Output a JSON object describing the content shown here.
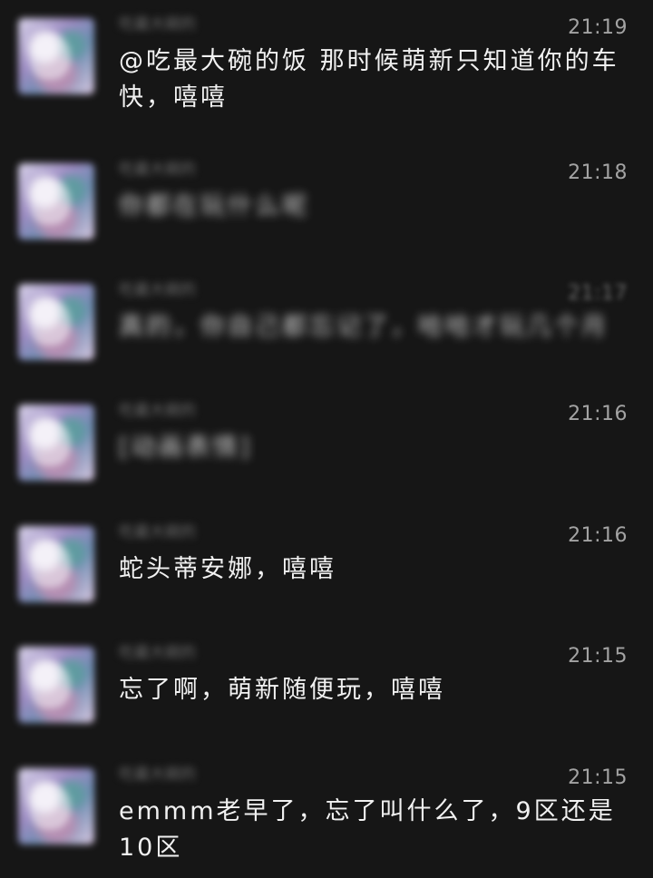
{
  "messages": [
    {
      "name": "吃最大碗的",
      "time": "21:19",
      "text": "@吃最大碗的饭 那时候萌新只知道你的车快，嘻嘻"
    },
    {
      "name": "吃最大碗的",
      "time": "21:18",
      "text": "你都在玩什么呢"
    },
    {
      "name": "吃最大碗的",
      "time": "21:17",
      "text": "真的，你自己都忘记了，哈哈才玩几个月"
    },
    {
      "name": "吃最大碗的",
      "time": "21:16",
      "text": "[动画表情]"
    },
    {
      "name": "吃最大碗的",
      "time": "21:16",
      "text": "蛇头蒂安娜，嘻嘻"
    },
    {
      "name": "吃最大碗的",
      "time": "21:15",
      "text": "忘了啊，萌新随便玩，嘻嘻"
    },
    {
      "name": "吃最大碗的",
      "time": "21:15",
      "text": "emmm老早了，忘了叫什么了，9区还是10区"
    }
  ]
}
